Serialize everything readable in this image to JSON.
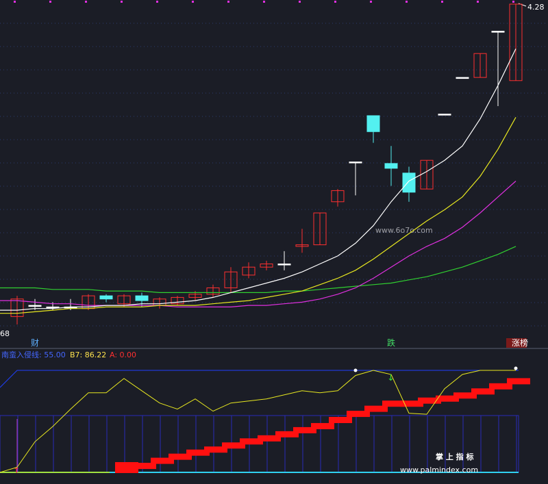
{
  "price_panel": {
    "price_high_label": "4.28",
    "price_low_label": "68",
    "candles": [
      {
        "o": 2.32,
        "c": 2.43,
        "h": 2.45,
        "l": 2.27,
        "color": "red"
      },
      {
        "o": 2.39,
        "c": 2.39,
        "h": 2.43,
        "l": 2.36,
        "color": "white"
      },
      {
        "o": 2.38,
        "c": 2.38,
        "h": 2.41,
        "l": 2.36,
        "color": "white"
      },
      {
        "o": 2.38,
        "c": 2.38,
        "h": 2.43,
        "l": 2.36,
        "color": "white"
      },
      {
        "o": 2.37,
        "c": 2.45,
        "h": 2.46,
        "l": 2.36,
        "color": "red"
      },
      {
        "o": 2.43,
        "c": 2.45,
        "h": 2.46,
        "l": 2.41,
        "color": "cyan"
      },
      {
        "o": 2.4,
        "c": 2.45,
        "h": 2.46,
        "l": 2.38,
        "color": "red"
      },
      {
        "o": 2.45,
        "c": 2.42,
        "h": 2.47,
        "l": 2.38,
        "color": "cyan"
      },
      {
        "o": 2.39,
        "c": 2.43,
        "h": 2.44,
        "l": 2.37,
        "color": "red"
      },
      {
        "o": 2.4,
        "c": 2.44,
        "h": 2.45,
        "l": 2.39,
        "color": "red"
      },
      {
        "o": 2.44,
        "c": 2.46,
        "h": 2.48,
        "l": 2.42,
        "color": "red"
      },
      {
        "o": 2.46,
        "c": 2.5,
        "h": 2.52,
        "l": 2.44,
        "color": "red"
      },
      {
        "o": 2.5,
        "c": 2.6,
        "h": 2.63,
        "l": 2.47,
        "color": "red"
      },
      {
        "o": 2.58,
        "c": 2.63,
        "h": 2.66,
        "l": 2.56,
        "color": "red"
      },
      {
        "o": 2.63,
        "c": 2.65,
        "h": 2.67,
        "l": 2.61,
        "color": "red"
      },
      {
        "o": 2.65,
        "c": 2.65,
        "h": 2.73,
        "l": 2.61,
        "color": "white"
      },
      {
        "o": 2.76,
        "c": 2.77,
        "h": 2.87,
        "l": 2.72,
        "color": "red"
      },
      {
        "o": 2.77,
        "c": 2.97,
        "h": 2.97,
        "l": 2.77,
        "color": "red"
      },
      {
        "o": 3.04,
        "c": 3.11,
        "h": 3.12,
        "l": 3.01,
        "color": "red"
      },
      {
        "o": 3.29,
        "c": 3.29,
        "h": 3.29,
        "l": 3.08,
        "color": "white"
      },
      {
        "o": 3.58,
        "c": 3.48,
        "h": 3.58,
        "l": 3.41,
        "color": "cyan"
      },
      {
        "o": 3.28,
        "c": 3.25,
        "h": 3.39,
        "l": 3.14,
        "color": "cyan"
      },
      {
        "o": 3.22,
        "c": 3.1,
        "h": 3.26,
        "l": 3.04,
        "color": "cyan"
      },
      {
        "o": 3.12,
        "c": 3.3,
        "h": 3.3,
        "l": 3.12,
        "color": "red"
      },
      {
        "o": 3.59,
        "c": 3.59,
        "h": 3.59,
        "l": 3.59,
        "color": "white"
      },
      {
        "o": 3.82,
        "c": 3.82,
        "h": 3.82,
        "l": 3.82,
        "color": "white"
      },
      {
        "o": 3.82,
        "c": 3.97,
        "h": 3.97,
        "l": 3.82,
        "color": "red"
      },
      {
        "o": 4.11,
        "c": 4.11,
        "h": 4.11,
        "l": 3.64,
        "color": "white"
      },
      {
        "o": 3.8,
        "c": 4.28,
        "h": 4.28,
        "l": 3.8,
        "color": "red"
      }
    ],
    "ma_white": [
      2.36,
      2.37,
      2.37,
      2.38,
      2.38,
      2.39,
      2.39,
      2.4,
      2.4,
      2.41,
      2.42,
      2.44,
      2.47,
      2.5,
      2.53,
      2.56,
      2.6,
      2.65,
      2.7,
      2.78,
      2.89,
      3.04,
      3.17,
      3.23,
      3.3,
      3.39,
      3.56,
      3.77,
      4.0
    ],
    "ma_yellow": [
      2.34,
      2.35,
      2.36,
      2.37,
      2.37,
      2.38,
      2.38,
      2.38,
      2.39,
      2.39,
      2.39,
      2.4,
      2.41,
      2.42,
      2.44,
      2.46,
      2.48,
      2.52,
      2.56,
      2.61,
      2.68,
      2.76,
      2.84,
      2.92,
      2.99,
      3.07,
      3.2,
      3.37,
      3.57
    ],
    "ma_magenta": [
      2.42,
      2.41,
      2.4,
      2.4,
      2.39,
      2.39,
      2.39,
      2.39,
      2.39,
      2.38,
      2.38,
      2.38,
      2.38,
      2.39,
      2.39,
      2.4,
      2.41,
      2.43,
      2.46,
      2.5,
      2.56,
      2.63,
      2.7,
      2.76,
      2.81,
      2.88,
      2.97,
      3.07,
      3.17
    ],
    "ma_green": [
      2.5,
      2.5,
      2.49,
      2.49,
      2.49,
      2.48,
      2.48,
      2.48,
      2.47,
      2.47,
      2.47,
      2.47,
      2.47,
      2.47,
      2.47,
      2.48,
      2.48,
      2.49,
      2.5,
      2.51,
      2.52,
      2.53,
      2.55,
      2.57,
      2.6,
      2.63,
      2.67,
      2.71,
      2.76
    ],
    "markers": [
      {
        "text": "财",
        "idx": 1,
        "color": "#5fb0ff"
      },
      {
        "text": "跌",
        "idx": 21,
        "color": "#44dd66"
      },
      {
        "text": "涨榜",
        "idx": 28,
        "color": "#ffffff"
      }
    ],
    "watermark": "www.6o7o.com"
  },
  "indicator_panel": {
    "legend": [
      {
        "label": "南蛮入侵线: 55.00",
        "color": "#4466ff"
      },
      {
        "label": "B7: 86.22",
        "color": "#ffe34d"
      },
      {
        "label": "A: 0.00",
        "color": "#ff3030"
      }
    ],
    "yellow_line": [
      5,
      30,
      45,
      62,
      78,
      78,
      92,
      80,
      68,
      62,
      72,
      60,
      68,
      70,
      72,
      76,
      80,
      78,
      80,
      95,
      100,
      96,
      58,
      57,
      82,
      96,
      100,
      100,
      100
    ],
    "red_steps": [
      null,
      null,
      null,
      null,
      null,
      null,
      2,
      6,
      11,
      15,
      19,
      22,
      26,
      30,
      33,
      37,
      41,
      45,
      51,
      57,
      62,
      67,
      67,
      70,
      72,
      75,
      79,
      84,
      89
    ],
    "brand_cn": "掌 上 指 标",
    "brand_url": "www.palmindex.com"
  },
  "colors": {
    "background": "#1b1d26",
    "grid": "#2b3a6e",
    "candle_red": "#ff3030",
    "candle_cyan": "#53f0f0",
    "ma_white": "#ffffff",
    "ma_yellow": "#e8e820",
    "ma_magenta": "#e030e0",
    "ma_green": "#30d030"
  }
}
